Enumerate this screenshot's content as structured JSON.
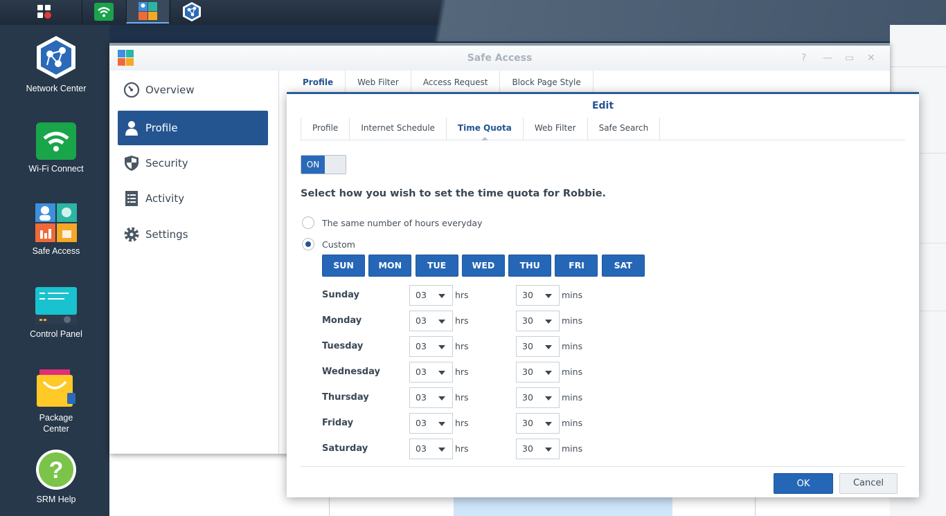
{
  "desktop": {
    "dock_items": [
      {
        "label": "Network Center",
        "icon": "network-center-icon"
      },
      {
        "label": "Wi-Fi Connect",
        "icon": "wifi-icon"
      },
      {
        "label": "Safe Access",
        "icon": "safe-access-icon"
      },
      {
        "label": "Control Panel",
        "icon": "control-panel-icon"
      },
      {
        "label": "Package\nCenter",
        "icon": "package-center-icon"
      },
      {
        "label": "SRM Help",
        "icon": "help-icon"
      }
    ]
  },
  "window": {
    "title": "Safe Access",
    "nav": [
      {
        "label": "Overview",
        "icon": "speedometer-icon"
      },
      {
        "label": "Profile",
        "icon": "user-icon",
        "selected": true
      },
      {
        "label": "Security",
        "icon": "shield-icon"
      },
      {
        "label": "Activity",
        "icon": "document-icon"
      },
      {
        "label": "Settings",
        "icon": "gear-icon"
      }
    ],
    "tabs": [
      "Profile",
      "Web Filter",
      "Access Request",
      "Block Page Style"
    ]
  },
  "dialog": {
    "title": "Edit",
    "tabs": [
      "Profile",
      "Internet Schedule",
      "Time Quota",
      "Web Filter",
      "Safe Search"
    ],
    "selected_tab": "Time Quota",
    "toggle_label": "ON",
    "heading": "Select how you wish to set the time quota for Robbie.",
    "options": [
      {
        "label": "The same number of hours everyday",
        "checked": false
      },
      {
        "label": "Custom",
        "checked": true
      }
    ],
    "day_buttons": [
      "SUN",
      "MON",
      "TUE",
      "WED",
      "THU",
      "FRI",
      "SAT"
    ],
    "hrs_unit": "hrs",
    "mins_unit": "mins",
    "quota": [
      {
        "day": "Sunday",
        "hours": "03",
        "mins": "30"
      },
      {
        "day": "Monday",
        "hours": "03",
        "mins": "30"
      },
      {
        "day": "Tuesday",
        "hours": "03",
        "mins": "30"
      },
      {
        "day": "Wednesday",
        "hours": "03",
        "mins": "30"
      },
      {
        "day": "Thursday",
        "hours": "03",
        "mins": "30"
      },
      {
        "day": "Friday",
        "hours": "03",
        "mins": "30"
      },
      {
        "day": "Saturday",
        "hours": "03",
        "mins": "30"
      }
    ],
    "ok_label": "OK",
    "cancel_label": "Cancel"
  },
  "colors": {
    "accent": "#245591",
    "button_blue": "#2567b6",
    "desktop_bg": "#263849"
  }
}
